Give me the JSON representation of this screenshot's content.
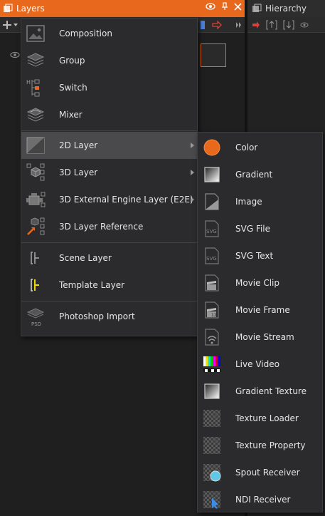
{
  "layers_panel": {
    "title": "Layers"
  },
  "hierarchy_panel": {
    "title": "Hierarchy"
  },
  "main_menu": {
    "items": [
      {
        "label": "Composition",
        "icon": "composition-icon"
      },
      {
        "label": "Group",
        "icon": "group-icon"
      },
      {
        "label": "Switch",
        "icon": "switch-icon"
      },
      {
        "label": "Mixer",
        "icon": "mixer-icon"
      },
      {
        "label": "2D Layer",
        "icon": "2d-layer-icon",
        "submenu": true,
        "highlighted": true
      },
      {
        "label": "3D Layer",
        "icon": "3d-layer-icon",
        "submenu": true
      },
      {
        "label": "3D External Engine Layer (E2E)",
        "icon": "e2e-layer-icon",
        "submenu": true
      },
      {
        "label": "3D Layer Reference",
        "icon": "3d-layer-reference-icon"
      },
      {
        "label": "Scene Layer",
        "icon": "scene-layer-icon"
      },
      {
        "label": "Template Layer",
        "icon": "template-layer-icon"
      },
      {
        "label": "Photoshop Import",
        "icon": "photoshop-import-icon"
      }
    ]
  },
  "submenu_2d": {
    "items": [
      {
        "label": "Color",
        "icon": "color-icon"
      },
      {
        "label": "Gradient",
        "icon": "gradient-icon"
      },
      {
        "label": "Image",
        "icon": "image-icon"
      },
      {
        "label": "SVG File",
        "icon": "svg-file-icon"
      },
      {
        "label": "SVG Text",
        "icon": "svg-text-icon"
      },
      {
        "label": "Movie Clip",
        "icon": "movie-clip-icon"
      },
      {
        "label": "Movie Frame",
        "icon": "movie-frame-icon"
      },
      {
        "label": "Movie Stream",
        "icon": "movie-stream-icon"
      },
      {
        "label": "Live Video",
        "icon": "live-video-icon"
      },
      {
        "label": "Gradient Texture",
        "icon": "gradient-texture-icon"
      },
      {
        "label": "Texture Loader",
        "icon": "texture-loader-icon"
      },
      {
        "label": "Texture Property",
        "icon": "texture-property-icon"
      },
      {
        "label": "Spout Receiver",
        "icon": "spout-receiver-icon"
      },
      {
        "label": "NDI Receiver",
        "icon": "ndi-receiver-icon"
      }
    ]
  },
  "colors": {
    "accent": "#e8681d",
    "menu_bg": "#2b2b2d",
    "highlight": "#4a4a4c"
  }
}
